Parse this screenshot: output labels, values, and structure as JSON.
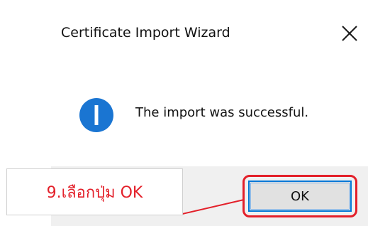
{
  "dialog": {
    "title": "Certificate Import Wizard",
    "close_icon": "close-icon",
    "message": "The import was successful.",
    "info_icon": "info-icon",
    "ok_label": "OK"
  },
  "annotation": {
    "callout_text": "9.เลือกปุ่ม OK",
    "color": "#e3202a"
  },
  "colors": {
    "accent": "#0078d7",
    "info_icon": "#1a75d2",
    "footer_bg": "#f0f0f0",
    "button_bg": "#e1e1e1"
  }
}
